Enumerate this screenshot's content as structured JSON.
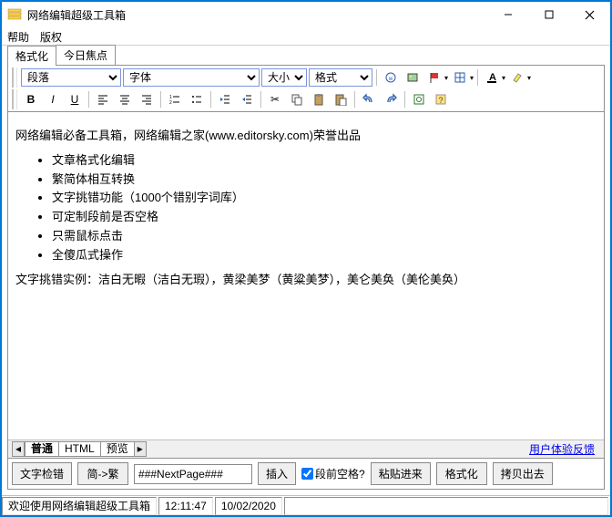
{
  "window": {
    "title": "网络编辑超级工具箱"
  },
  "menubar": {
    "help": "帮助",
    "copyright": "版权"
  },
  "main_tabs": {
    "format": "格式化",
    "today_focus": "今日焦点"
  },
  "toolbar": {
    "paragraph": "段落",
    "font": "字体",
    "size": "大小",
    "format": "格式"
  },
  "editor": {
    "intro": "网络编辑必备工具箱，网络编辑之家(www.editorsky.com)荣誉出品",
    "items": [
      "文章格式化编辑",
      "繁简体相互转换",
      "文字挑错功能（1000个错别字词库）",
      "可定制段前是否空格",
      "只需鼠标点击",
      "全傻瓜式操作"
    ],
    "example": "文字挑错实例：洁白无暇（洁白无瑕），黄梁美梦（黄粱美梦），美仑美奂（美伦美奂）"
  },
  "bottom_tabs": {
    "normal": "普通",
    "html": "HTML",
    "preview": "预览"
  },
  "feedback_link": "用户体验反馈",
  "actions": {
    "check_text": "文字检错",
    "simp_to_trad": "简->繁",
    "nextpage_value": "###NextPage###",
    "insert": "插入",
    "space_before": "段前空格?",
    "paste_in": "粘贴进来",
    "format": "格式化",
    "copy_out": "拷贝出去"
  },
  "status": {
    "welcome": "欢迎使用网络编辑超级工具箱",
    "time": "12:11:47",
    "date": "10/02/2020"
  }
}
